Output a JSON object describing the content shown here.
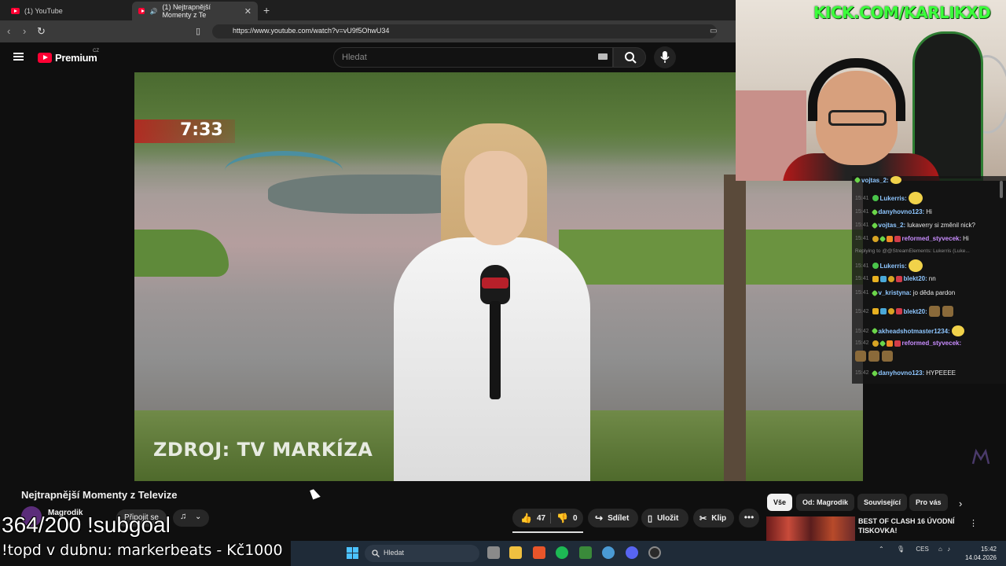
{
  "browser": {
    "tabs": [
      {
        "label": "(1) YouTube"
      },
      {
        "label": "(1) Nejtrapnější Momenty z Te"
      }
    ],
    "url": "https://www.youtube.com/watch?v=vU9f5OhwU34"
  },
  "youtube": {
    "logo_text": "Premium",
    "country": "CZ",
    "search_placeholder": "Hledat"
  },
  "video": {
    "clock_overlay": "7:33",
    "source_overlay": "ZDROJ: TV MARKÍZA",
    "title": "Nejtrapnější Momenty z Televize",
    "channel": "Magrodik",
    "join_label": "Připojit se",
    "likes": "47",
    "dislikes": "0",
    "share_label": "Sdílet",
    "save_label": "Uložit",
    "clip_label": "Klip",
    "more_label": "•••"
  },
  "recommendations": {
    "chips": [
      "Vše",
      "Od: Magrodik",
      "Související",
      "Pro vás"
    ],
    "first_title": "BEST OF CLASH 16 ÚVODNÍ TISKOVKA!"
  },
  "stream": {
    "kick_url": "KICK.COM/KARLIKXD",
    "subgoal": "364/200 !subgoal",
    "topd": "!topd v dubnu: markerbeats - Kč1000"
  },
  "chat": {
    "messages": [
      {
        "time": "",
        "user": "vojtas_2:",
        "text": ""
      },
      {
        "time": "15:41",
        "user": "Lukerris:",
        "text": ""
      },
      {
        "time": "15:41",
        "user": "danyhovno123:",
        "text": "Hi"
      },
      {
        "time": "15:41",
        "user": "vojtas_2:",
        "text": "lukaverry si změnil nick?"
      },
      {
        "time": "15:41",
        "user": "reformed_styvecek:",
        "text": "Hi"
      },
      {
        "time": "",
        "user": "",
        "text": "Replying to @@StreamElements: Lukerris (Luke..."
      },
      {
        "time": "15:41",
        "user": "Lukerris:",
        "text": ""
      },
      {
        "time": "15:41",
        "user": "blekt20:",
        "text": "nn"
      },
      {
        "time": "15:41",
        "user": "v_kristyna:",
        "text": "jo děda pardon"
      },
      {
        "time": "15:42",
        "user": "blekt20:",
        "text": ""
      },
      {
        "time": "15:42",
        "user": "akheadshotmaster1234:",
        "text": ""
      },
      {
        "time": "15:42",
        "user": "reformed_styvecek:",
        "text": ""
      },
      {
        "time": "15:42",
        "user": "danyhovno123:",
        "text": "HYPEEEE"
      }
    ]
  },
  "taskbar": {
    "search_placeholder": "Hledat",
    "lang": "CES",
    "time": "15:42",
    "date": "14.04.2026"
  },
  "colors": {
    "youtube_red": "#ff0033",
    "kick_green": "#3bff3b",
    "background": "#0f0f0f"
  }
}
